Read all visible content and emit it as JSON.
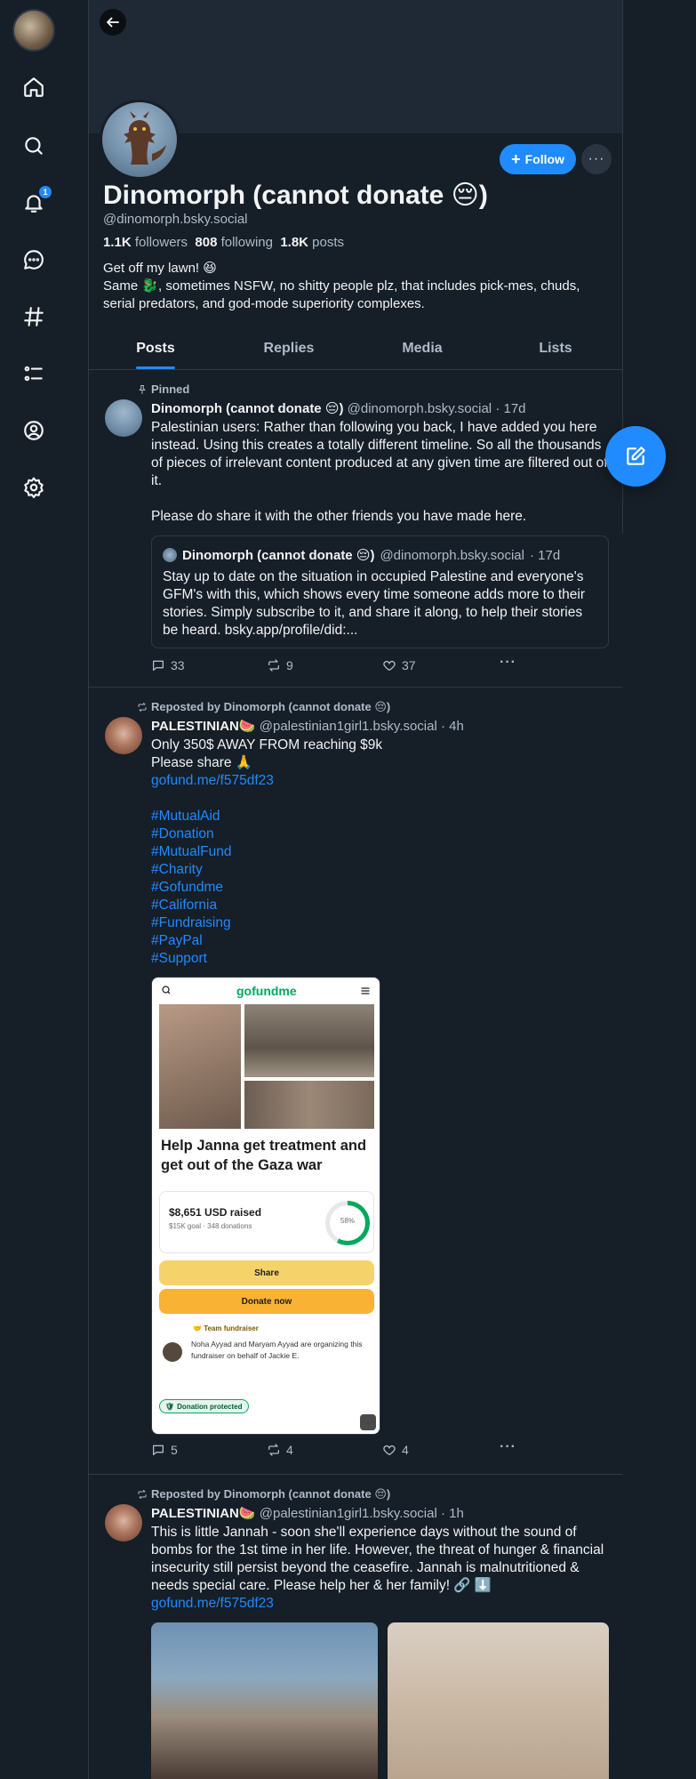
{
  "nav": {
    "notifications_badge": "1"
  },
  "profile": {
    "display_name": "Dinomorph (cannot donate 😔)",
    "handle": "@dinomorph.bsky.social",
    "followers_count": "1.1K",
    "followers_label": "followers",
    "following_count": "808",
    "following_label": "following",
    "posts_count": "1.8K",
    "posts_label": "posts",
    "bio_line1": "Get off my lawn! 😆",
    "bio_line2": "Same 🐉, sometimes NSFW, no shitty people plz, that includes pick-mes, chuds, serial predators, and god-mode superiority complexes.",
    "follow_label": "Follow",
    "more_label": "···"
  },
  "tabs": [
    {
      "label": "Posts"
    },
    {
      "label": "Replies"
    },
    {
      "label": "Media"
    },
    {
      "label": "Lists"
    }
  ],
  "posts": [
    {
      "context": "Pinned",
      "author": "Dinomorph (cannot donate 😔)",
      "handle": "@dinomorph.bsky.social",
      "time": "· 17d",
      "text_p1": "Palestinian users: Rather than following you back, I have added you here instead. Using this creates a totally different timeline. So all the thousands of pieces of irrelevant content produced at any given time are filtered out of it.",
      "text_p2": "Please do share it with the other friends you have made here.",
      "quote": {
        "author": "Dinomorph (cannot donate 😔)",
        "handle": "@dinomorph.bsky.social",
        "time": "· 17d",
        "text": "Stay up to date on the situation in occupied Palestine and everyone's GFM's with this, which shows every time someone adds more to their stories. Simply subscribe to it, and share it along, to help their stories be heard. bsky.app/profile/did:..."
      },
      "replies": "33",
      "reposts": "9",
      "likes": "37"
    },
    {
      "context": "Reposted by Dinomorph (cannot donate 😔)",
      "author": "PALESTINIAN🍉",
      "handle": "@palestinian1girl1.bsky.social",
      "time": "· 4h",
      "line1": "Only  350$ AWAY FROM reaching $9k",
      "line2": "Please share 🙏",
      "link": "gofund.me/f575df23",
      "hashtags": [
        "#MutualAid",
        "#Donation",
        "#MutualFund",
        "#Charity",
        "#Gofundme",
        "#California",
        "#Fundraising",
        "#PayPal",
        "#Support"
      ],
      "image": {
        "logo": "gofundme",
        "title": "Help Janna get treatment and get out of the Gaza war",
        "raised": "$8,651 USD raised",
        "goal": "$15K goal  ·  348 donations",
        "percent_label": "58%",
        "progress": 0.58,
        "share_label": "Share",
        "donate_label": "Donate now",
        "team_label": "Team fundraiser",
        "organizer_text": "Noha Ayyad and Maryam Ayyad are organizing this fundraiser on behalf of Jackie E.",
        "protected_label": "Donation protected"
      },
      "replies": "5",
      "reposts": "4",
      "likes": "4"
    },
    {
      "context": "Reposted by Dinomorph (cannot donate 😔)",
      "author": "PALESTINIAN🍉",
      "handle": "@palestinian1girl1.bsky.social",
      "time": "· 1h",
      "text": "This is little Jannah - soon she'll experience days without the sound of bombs for the 1st time in her life. However, the threat of hunger & financial insecurity still persist beyond the ceasefire. Jannah is malnutritioned & needs special care. Please help her & her family! 🔗 ⬇️",
      "link": "gofund.me/f575df23"
    }
  ],
  "colors": {
    "accent": "#208bfe",
    "background": "#161e27",
    "border": "#2e3a46",
    "muted": "#aebbc9"
  }
}
